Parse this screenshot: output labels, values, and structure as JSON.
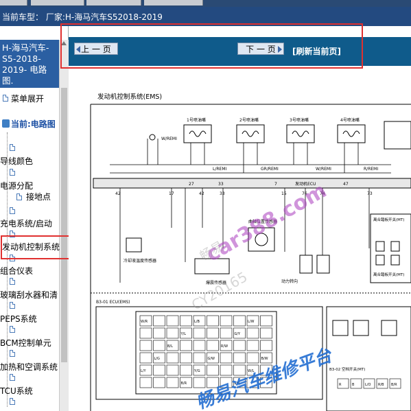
{
  "vehicle_bar": {
    "text": "当前车型：  厂家:H-海马汽车S52018-2019"
  },
  "sidebar": {
    "title": "H-海马汽车-S5-2018-2019- 电路图.",
    "menu_toggle": "菜单展开",
    "current_label": "当前:电路图",
    "items": [
      "导线颜色",
      "电源分配",
      "接地点",
      "充电系统/启动",
      "发动机控制系统",
      "组合仪表",
      "玻璃刮水器和清",
      "PEPS系统",
      "BCM控制单元",
      "加热和空调系统",
      "TCU系统"
    ]
  },
  "nav": {
    "prev_label": "上 一 页",
    "next_label": "下 一 页",
    "refresh_label": "[刷新当前页]"
  },
  "diagram": {
    "title": "发动机控制系统(EMS)",
    "labels": {
      "injector1": "1号喷油嘴",
      "injector2": "2号喷油嘴",
      "injector3": "3号喷油嘴",
      "injector4": "4号喷油嘴",
      "ecu": "发动机ECU",
      "coolant": "冷却液温度传感器",
      "crank": "曲轴位置传感器",
      "knock": "爆震传感器",
      "power_steer": "动力转向",
      "clutch_a": "离合踏板开关(MT)",
      "clutch_b": "离合踏板开关(MT)",
      "ecu_conn": "B3-01 ECU(EMS)",
      "connector_b3_02": "B3-02 空档开关(MT)"
    },
    "wires": [
      "W/REMI",
      "L/REMI",
      "GR/REMI",
      "W/REMI",
      "R/REMI",
      "W/B",
      "L/Y",
      "G/R",
      "Y/G",
      "R/G",
      "B/R",
      "L/W"
    ],
    "pins": [
      "27",
      "33",
      "17",
      "42",
      "47",
      "7",
      "15",
      "76",
      "74",
      "54",
      "58",
      "72",
      "73"
    ],
    "ecu_grid": [
      "W/R",
      "L/B",
      "L/W",
      "Y/L",
      "G/Y",
      "B/L",
      "R/W",
      "L/G",
      "G/W",
      "B/W",
      "L/Y",
      "Y/G",
      "W/L",
      "B/R",
      "L/R"
    ],
    "connector_pins": [
      "R",
      "B",
      "L/O",
      "R/B",
      "B/R"
    ]
  },
  "watermarks": {
    "main": "car388.com",
    "site": "畅易汽车维修平台",
    "code": "CY20165",
    "short": "畅易"
  }
}
